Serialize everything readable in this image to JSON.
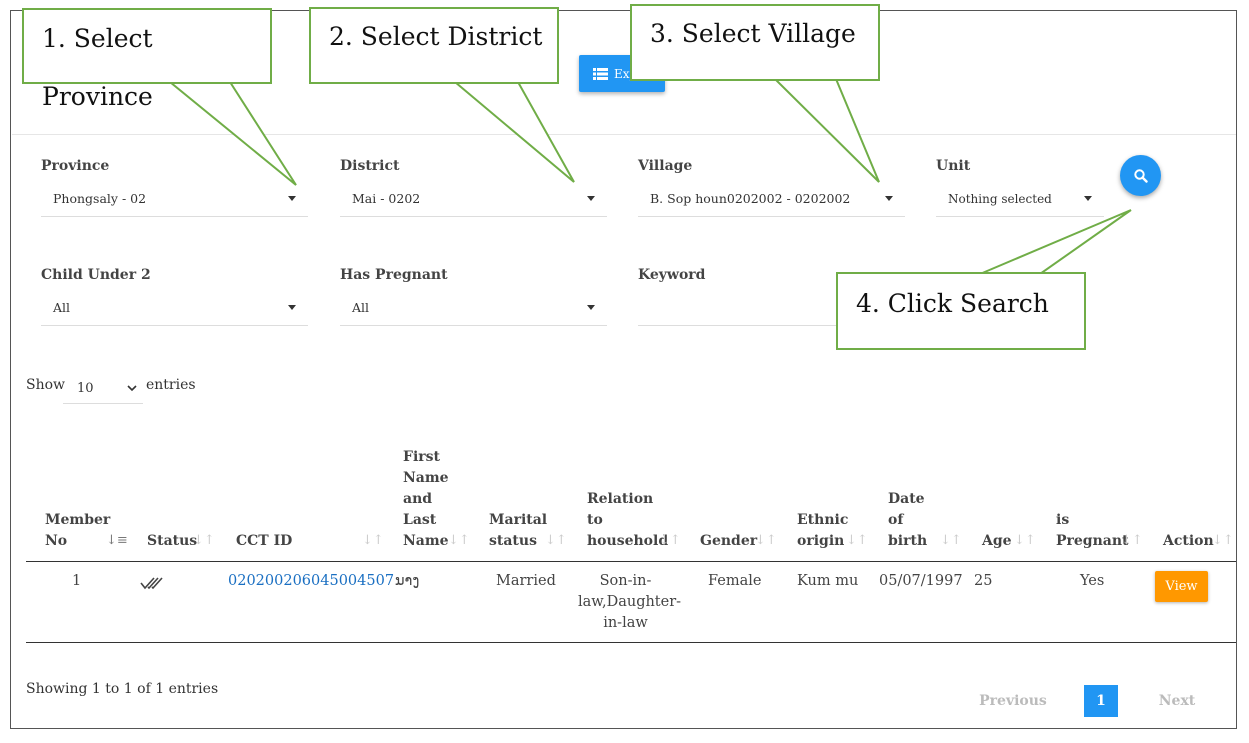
{
  "toolbar": {
    "export_label": "Export"
  },
  "filters": {
    "province": {
      "label": "Province",
      "value": "Phongsaly - 02"
    },
    "district": {
      "label": "District",
      "value": "Mai - 0202"
    },
    "village": {
      "label": "Village",
      "value": "B. Sop houn0202002 - 0202002"
    },
    "unit": {
      "label": "Unit",
      "value": "Nothing selected"
    },
    "child_under_2": {
      "label": "Child Under 2",
      "value": "All"
    },
    "has_pregnant": {
      "label": "Has Pregnant",
      "value": "All"
    },
    "keyword": {
      "label": "Keyword",
      "value": ""
    }
  },
  "callouts": {
    "c1": "1. Select Province",
    "c2": "2. Select District",
    "c3": "3. Select Village",
    "c4": "4. Click Search"
  },
  "length_menu": {
    "show": "Show",
    "value": "10",
    "entries": "entries"
  },
  "table": {
    "headers": {
      "member_no": [
        "Member",
        "No"
      ],
      "status": "Status",
      "cct_id": "CCT ID",
      "name": [
        "First",
        "Name",
        "and",
        "Last",
        "Name"
      ],
      "marital": [
        "Marital",
        "status"
      ],
      "relation": [
        "Relation",
        "to",
        "household"
      ],
      "gender": "Gender",
      "ethnic": [
        "Ethnic",
        "origin"
      ],
      "dob": [
        "Date",
        "of",
        "birth"
      ],
      "age": "Age",
      "pregnant": [
        "is",
        "Pregnant"
      ],
      "action": "Action"
    },
    "rows": [
      {
        "member_no": "1",
        "status_icon": "double-check-icon",
        "cct_id": "020200206045004507",
        "name": "ນາງ",
        "marital": "Married",
        "relation": [
          "Son-in-",
          "law,Daughter-",
          "in-law"
        ],
        "gender": "Female",
        "ethnic": "Kum mu",
        "dob": "05/07/1997",
        "age": "25",
        "pregnant": "Yes",
        "action": "View"
      }
    ]
  },
  "footer": {
    "info": "Showing 1 to 1 of 1 entries",
    "previous": "Previous",
    "page": "1",
    "next": "Next"
  },
  "colors": {
    "primary": "#2196f3",
    "accent": "#ff9800",
    "callout_border": "#70ad47",
    "link": "#1a6fc2"
  }
}
